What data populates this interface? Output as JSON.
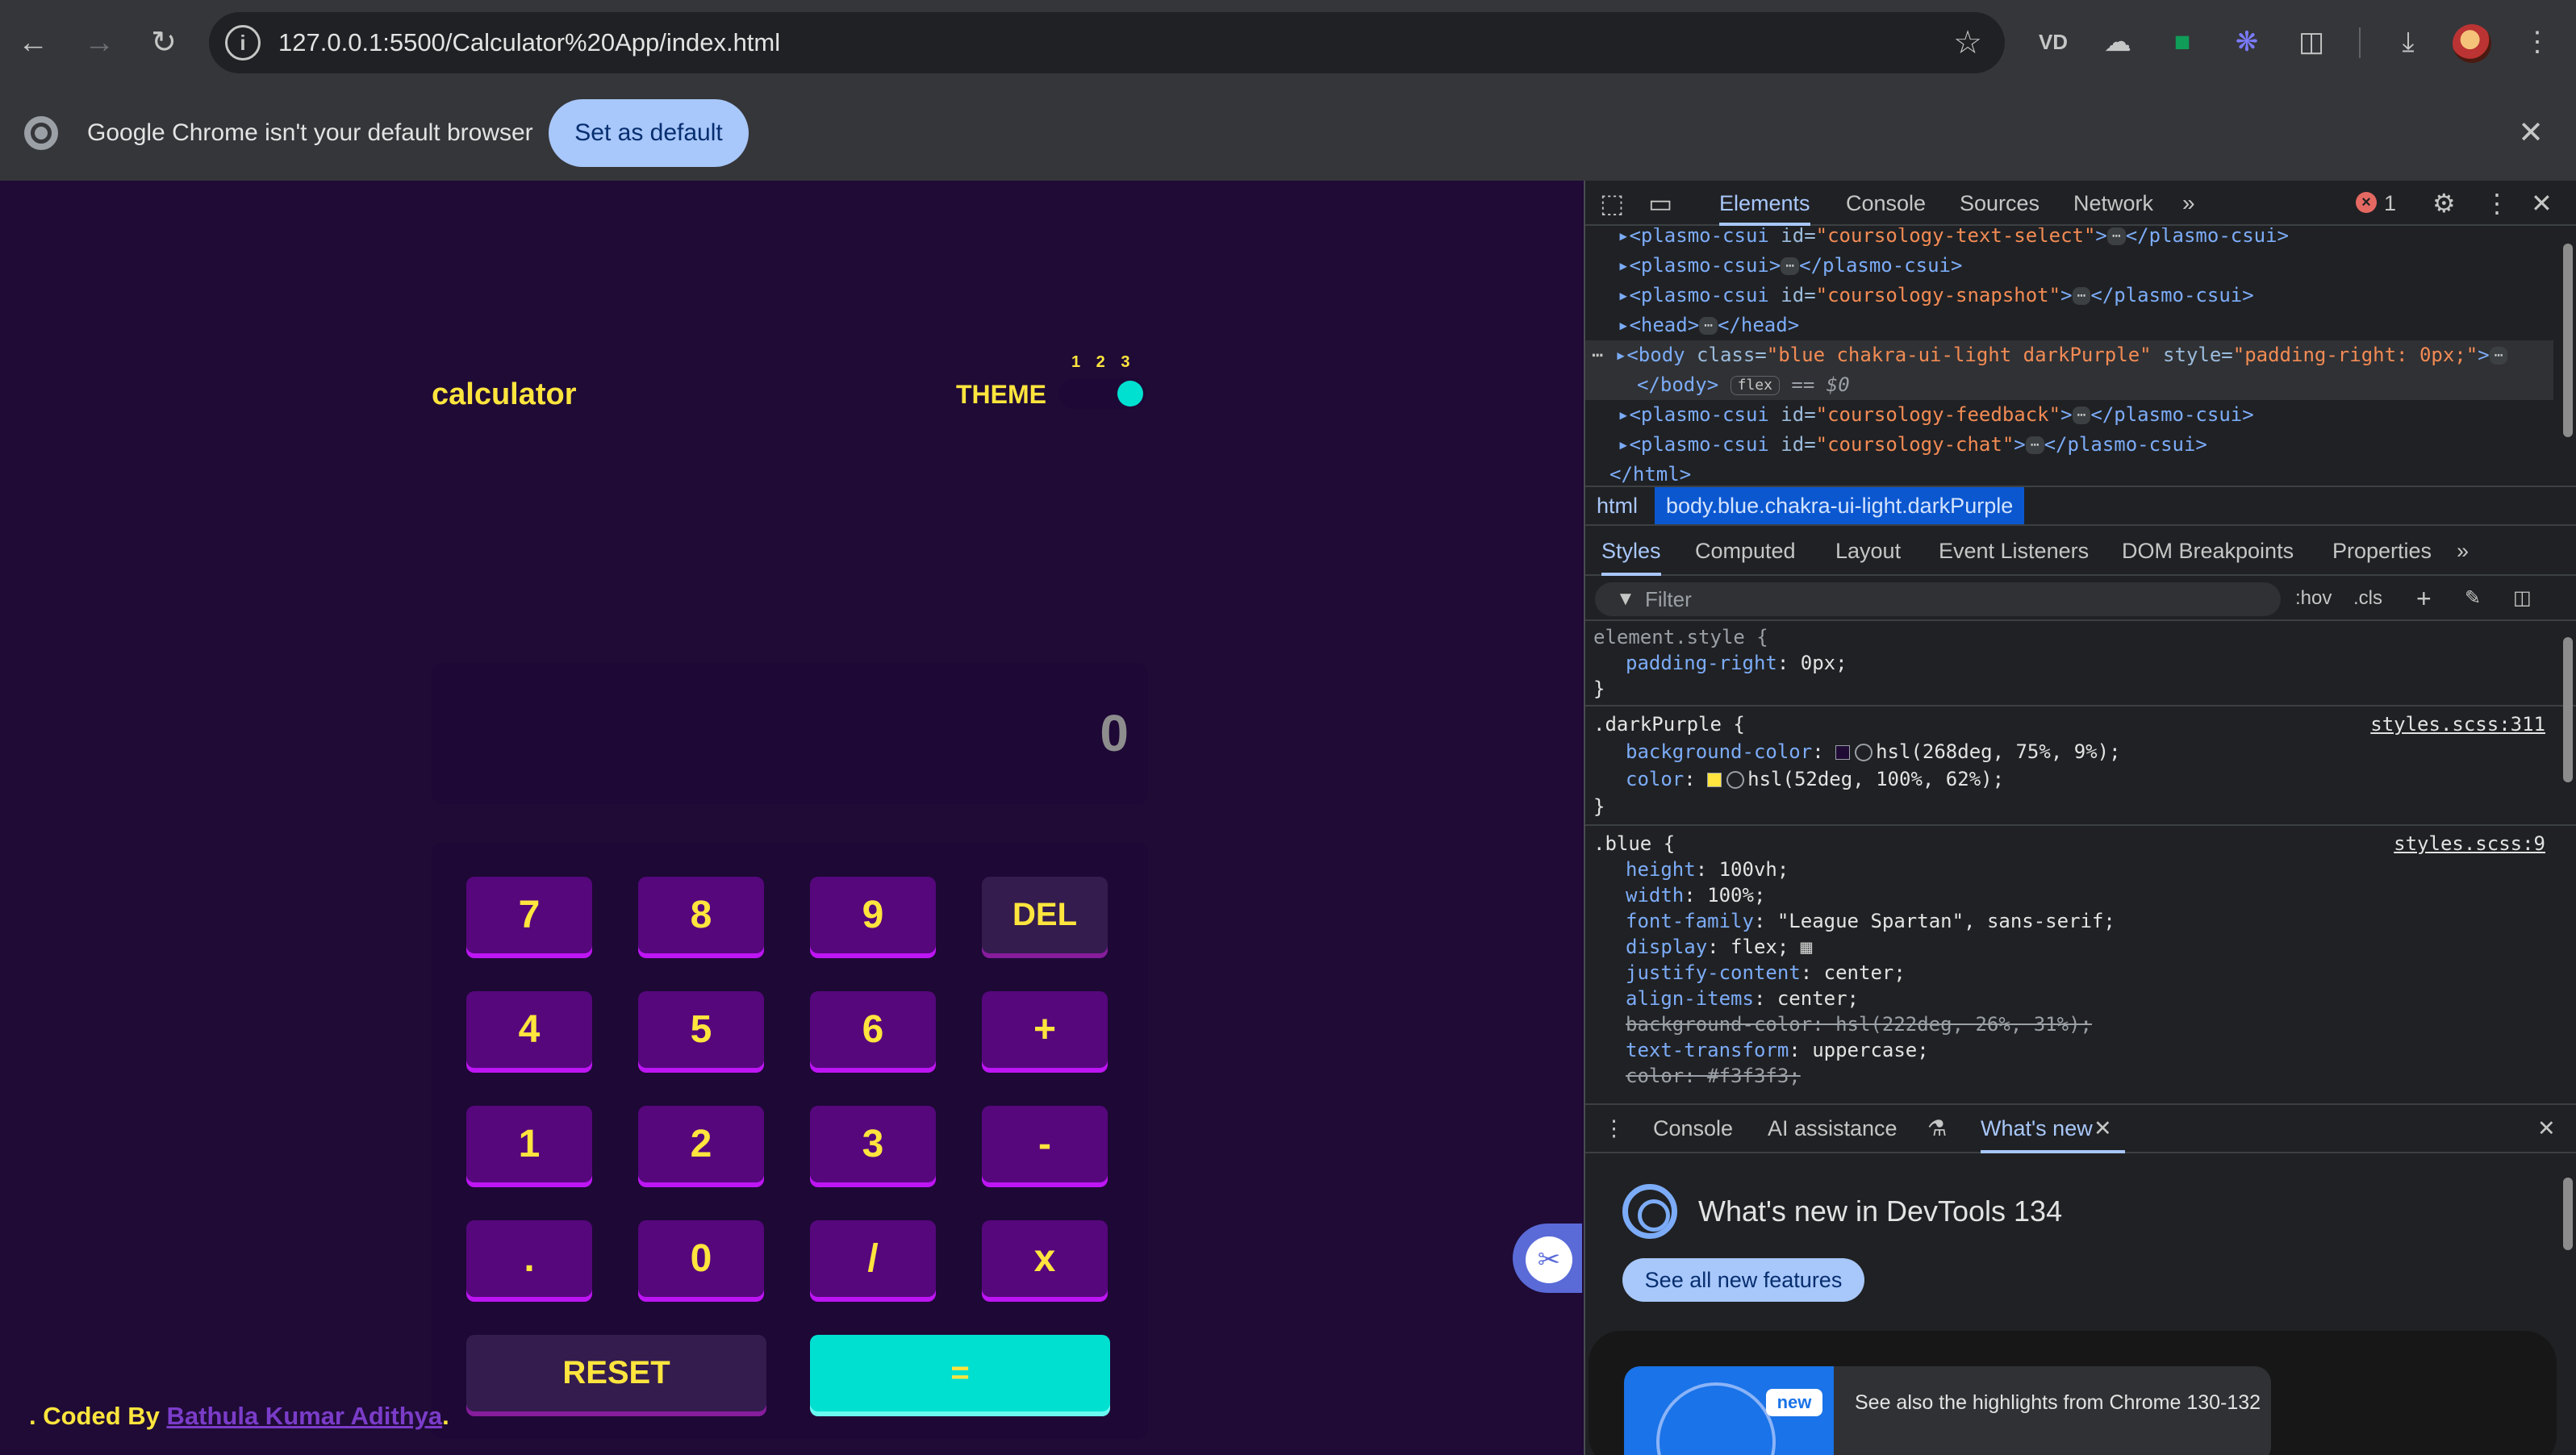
{
  "browser": {
    "url": "127.0.0.1:5500/Calculator%20App/index.html",
    "infobar_text": "Google Chrome isn't your default browser",
    "set_default_label": "Set as default",
    "ext_vd_label": "VD"
  },
  "calculator": {
    "title": "calculator",
    "theme_label": "THEME",
    "theme_numbers": "1 2 3",
    "display_value": "0",
    "keys": [
      "7",
      "8",
      "9",
      "DEL",
      "4",
      "5",
      "6",
      "+",
      "1",
      "2",
      "3",
      "-",
      ".",
      "0",
      "/",
      "x"
    ],
    "reset_label": "RESET",
    "equals_label": "=",
    "footer_prefix": ". Coded By ",
    "footer_author": "Bathula Kumar Adithya",
    "footer_suffix": ".",
    "colors": {
      "background": "#1f0b36",
      "accent": "#00e0d1",
      "text": "#ffe53d",
      "key": "#56077c"
    }
  },
  "devtools": {
    "tabs": [
      "Elements",
      "Console",
      "Sources",
      "Network"
    ],
    "error_count": "1",
    "dom_lines": {
      "l1_tag": "<plasmo-csui",
      "l1_attr": " id=",
      "l1_val": "\"coursology-text-select\"",
      "l1_close": "</plasmo-csui>",
      "l2_tag": "<plasmo-csui>",
      "l2_close": "</plasmo-csui>",
      "l3_val": "\"coursology-snapshot\"",
      "l4_tag": "<head>",
      "l4_close": "</head>",
      "l5_tag": "<body",
      "l5_class_attr": " class=",
      "l5_class_val": "\"blue chakra-ui-light darkPurple\"",
      "l5_style_attr": " style=",
      "l5_style_val": "\"padding-right: 0px;\"",
      "l6_close": "</body>",
      "l6_badge": "flex",
      "l6_ref": "== $0",
      "l7_val": "\"coursology-feedback\"",
      "l8_val": "\"coursology-chat\"",
      "l9": "</html>",
      "ellipsis": "⋯"
    },
    "breadcrumbs": [
      "html",
      "body.blue.chakra-ui-light.darkPurple"
    ],
    "style_tabs": [
      "Styles",
      "Computed",
      "Layout",
      "Event Listeners",
      "DOM Breakpoints",
      "Properties"
    ],
    "filter_placeholder": "Filter",
    "hov": ":hov",
    "cls": ".cls",
    "styles": {
      "element_selector": "element.style {",
      "element_prop": "padding-right",
      "element_val": ": 0px;",
      "close": "}",
      "dp_selector": ".darkPurple {",
      "dp_src": "styles.scss:311",
      "dp_bg_name": "background-color",
      "dp_bg_val": "hsl(268deg, 75%, 9%);",
      "dp_color_name": "color",
      "dp_color_val": "hsl(52deg, 100%, 62%);",
      "blue_selector": ".blue {",
      "blue_src": "styles.scss:9",
      "height": "height",
      "height_val": ": 100vh;",
      "width": "width",
      "width_val": ": 100%;",
      "font_family": "font-family",
      "font_family_val": ": \"League Spartan\", sans-serif;",
      "display": "display",
      "display_val": ": flex;",
      "justify": "justify-content",
      "justify_val": ": center;",
      "align": "align-items",
      "align_val": ": center;",
      "bg_strike": "background-color: hsl(222deg, 26%, 31%);",
      "transform": "text-transform",
      "transform_val": ": uppercase;",
      "color_strike": "color: #f3f3f3;"
    },
    "drawer_tabs": [
      "Console",
      "AI assistance",
      "What's new"
    ],
    "whats_new_title": "What's new in DevTools 134",
    "see_all_label": "See all new features",
    "new_badge": "new",
    "highlights_text": "See also the highlights from Chrome 130-132"
  }
}
